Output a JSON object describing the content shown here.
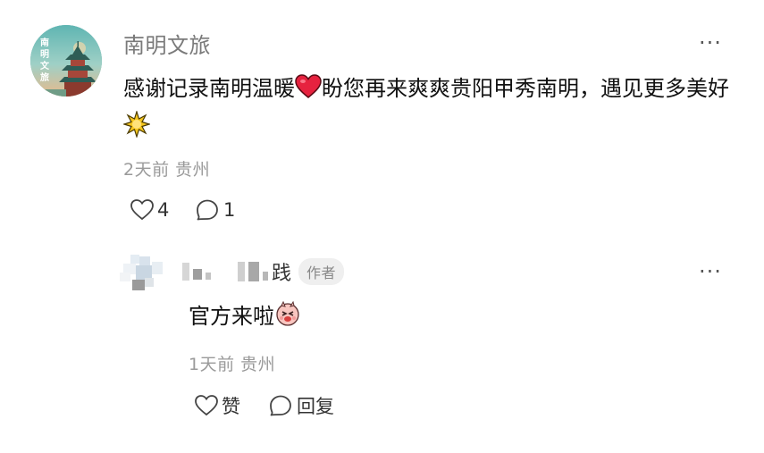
{
  "comment": {
    "username": "南明文旅",
    "avatar_text": "南明文旅",
    "text_part1": "感谢记录南明温暖",
    "text_part2": "盼您再来爽爽贵阳甲秀南明，遇见更多美好",
    "emoji1": "heart-emoji",
    "emoji2": "sparkle-emoji",
    "meta": "2天前 贵州",
    "like_count": "4",
    "reply_count": "1",
    "more": "···"
  },
  "reply": {
    "name_visible_char": "践",
    "author_badge": "作者",
    "text": "官方来啦",
    "emoji": "cute-face-emoji",
    "meta": "1天前 贵州",
    "like_label": "赞",
    "reply_label": "回复",
    "more": "···"
  },
  "colors": {
    "muted_text": "#9a9a9a",
    "username": "#7a7a7a",
    "heart": "#e6223f",
    "badge_bg": "#efefef"
  }
}
